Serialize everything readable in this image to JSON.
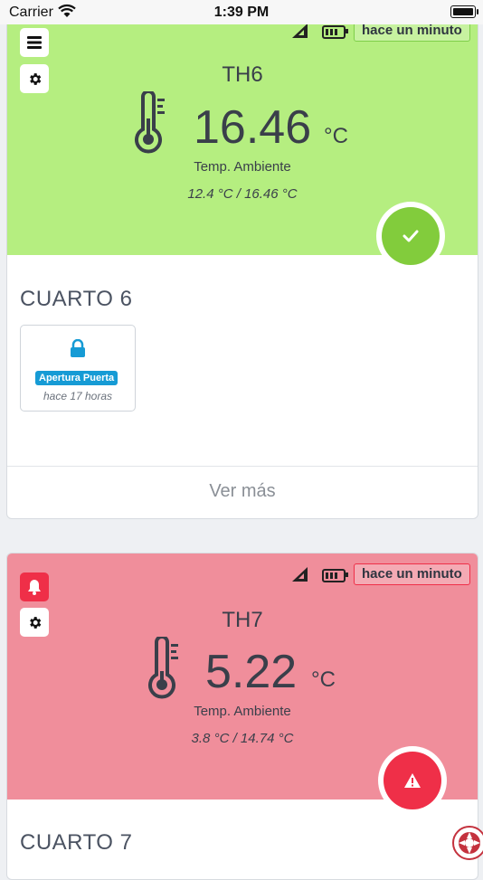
{
  "status_bar": {
    "carrier": "Carrier",
    "time": "1:39 PM"
  },
  "cards": [
    {
      "sensor_name": "TH6",
      "last_update": "hace un minuto",
      "value": "16.46",
      "unit": "°C",
      "measure_label": "Temp. Ambiente",
      "range": "12.4 °C / 16.46 °C",
      "room": "CUARTO 6",
      "panel_color": "#b5ee80",
      "status": "ok",
      "event": {
        "label": "Apertura Puerta",
        "ago": "hace 17 horas"
      },
      "more_label": "Ver más"
    },
    {
      "sensor_name": "TH7",
      "last_update": "hace un minuto",
      "value": "5.22",
      "unit": "°C",
      "measure_label": "Temp. Ambiente",
      "range": "3.8 °C / 14.74 °C",
      "room": "CUARTO 7",
      "panel_color": "#f08e9b",
      "status": "alert"
    }
  ],
  "colors": {
    "ok_accent": "#82cc3c",
    "alert_accent": "#ef2f48",
    "event_tag": "#169bd5"
  }
}
